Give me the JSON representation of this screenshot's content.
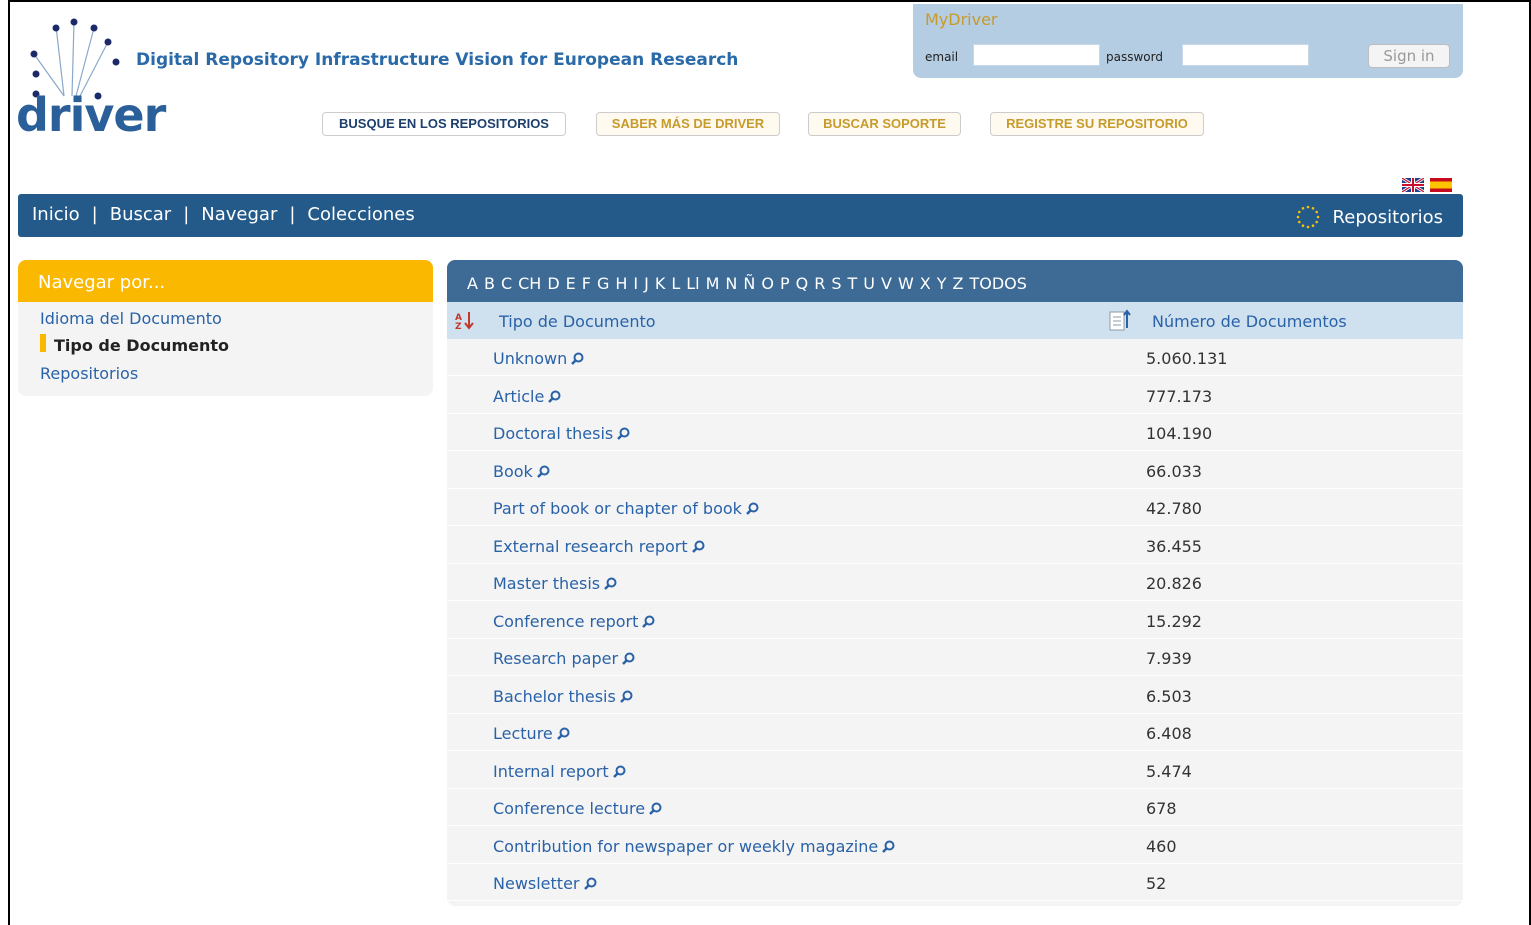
{
  "header": {
    "logo_text": "driver",
    "tagline": "Digital Repository Infrastructure Vision for European Research"
  },
  "mydriver": {
    "title": "MyDriver",
    "email_label": "email",
    "password_label": "password",
    "email_value": "",
    "password_value": "",
    "sign_in_label": "Sign in"
  },
  "top_buttons": [
    {
      "label": "BUSQUE EN LOS REPOSITORIOS"
    },
    {
      "label": "SABER MÁS DE DRIVER"
    },
    {
      "label": "BUSCAR SOPORTE"
    },
    {
      "label": "REGISTRE SU REPOSITORIO"
    }
  ],
  "languages": [
    "english-flag",
    "spanish-flag"
  ],
  "navbar": {
    "items": [
      "Inicio",
      "Buscar",
      "Navegar",
      "Colecciones"
    ],
    "separator": "|",
    "repositories_label": "Repositorios"
  },
  "sidebar": {
    "heading": "Navegar por...",
    "items": [
      {
        "label": "Idioma del Documento",
        "active": false
      },
      {
        "label": "Tipo de Documento",
        "active": true
      },
      {
        "label": "Repositorios",
        "active": false
      }
    ]
  },
  "browse": {
    "letters": [
      "A",
      "B",
      "C",
      "CH",
      "D",
      "E",
      "F",
      "G",
      "H",
      "I",
      "J",
      "K",
      "L",
      "Ll",
      "M",
      "N",
      "Ñ",
      "O",
      "P",
      "Q",
      "R",
      "S",
      "T",
      "U",
      "V",
      "W",
      "X",
      "Y",
      "Z",
      "TODOS"
    ],
    "column_type": "Tipo de Documento",
    "column_count": "Número de Documentos",
    "rows": [
      {
        "type": "Unknown",
        "count": "5.060.131"
      },
      {
        "type": "Article",
        "count": "777.173"
      },
      {
        "type": "Doctoral thesis",
        "count": "104.190"
      },
      {
        "type": "Book",
        "count": "66.033"
      },
      {
        "type": "Part of book or chapter of book",
        "count": "42.780"
      },
      {
        "type": "External research report",
        "count": "36.455"
      },
      {
        "type": "Master thesis",
        "count": "20.826"
      },
      {
        "type": "Conference report",
        "count": "15.292"
      },
      {
        "type": "Research paper",
        "count": "7.939"
      },
      {
        "type": "Bachelor thesis",
        "count": "6.503"
      },
      {
        "type": "Lecture",
        "count": "6.408"
      },
      {
        "type": "Internal report",
        "count": "5.474"
      },
      {
        "type": "Conference lecture",
        "count": "678"
      },
      {
        "type": "Contribution for newspaper or weekly magazine",
        "count": "460"
      },
      {
        "type": "Newsletter",
        "count": "52"
      }
    ]
  },
  "colors": {
    "nav_blue": "#235a89",
    "header_blue": "#3d6b95",
    "accent_orange": "#fbb800",
    "link_blue": "#2a62a8",
    "gold": "#c79a2c"
  }
}
